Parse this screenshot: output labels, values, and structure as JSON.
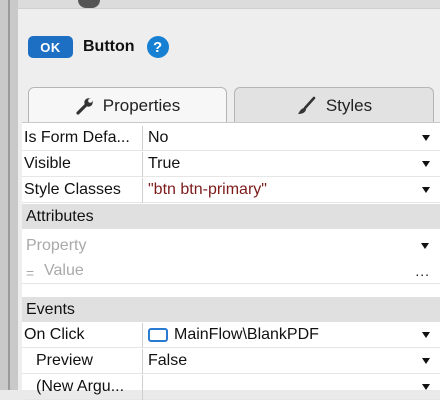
{
  "widget": {
    "badge": "OK",
    "title": "Button",
    "help_icon": "?"
  },
  "tabs": [
    {
      "label": "Properties",
      "icon": "wrench-icon",
      "active": true
    },
    {
      "label": "Styles",
      "icon": "brush-icon",
      "active": false
    }
  ],
  "properties": [
    {
      "label": "Is Form Defa...",
      "value": "No"
    },
    {
      "label": "Visible",
      "value": "True"
    },
    {
      "label": "Style Classes",
      "value": "\"btn btn-primary\""
    }
  ],
  "attributes": {
    "section_label": "Attributes",
    "property_placeholder": "Property",
    "equals": "=",
    "value_placeholder": "Value",
    "ellipsis": "..."
  },
  "events": {
    "section_label": "Events",
    "on_click": {
      "label": "On Click",
      "value": "MainFlow\\BlankPDF"
    },
    "preview": {
      "label": "Preview",
      "value": "False"
    },
    "new_argument": {
      "label": "(New Argu..."
    }
  },
  "colors": {
    "ok_badge": "#1d6fc4",
    "help_icon": "#1780d2",
    "string_value": "#7d1b1b",
    "section_bg": "#e0e0e0"
  }
}
